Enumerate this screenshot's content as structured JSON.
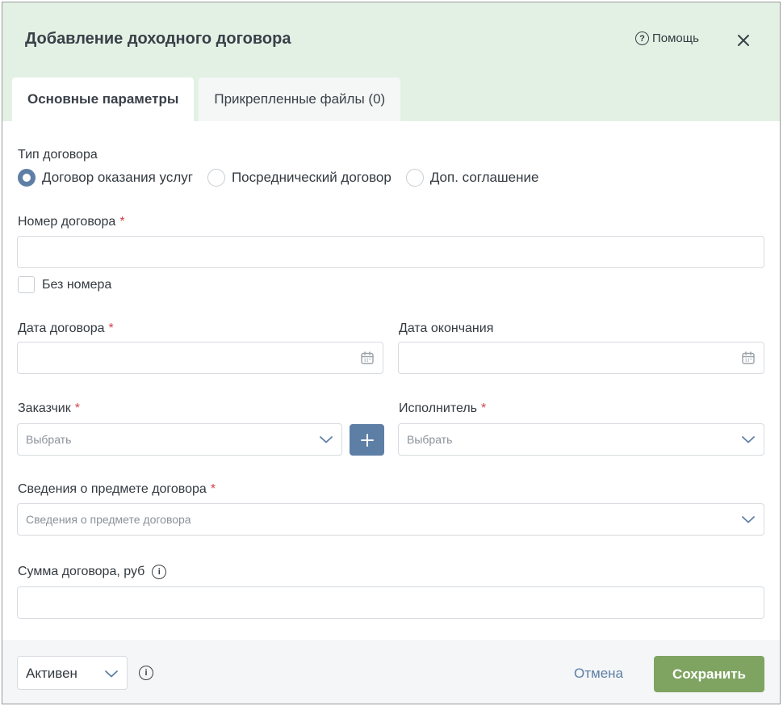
{
  "dialog": {
    "title": "Добавление доходного договора",
    "help_label": "Помощь"
  },
  "tabs": [
    {
      "label": "Основные параметры",
      "active": true
    },
    {
      "label": "Прикрепленные файлы (0)",
      "active": false
    }
  ],
  "contract_type": {
    "label": "Тип договора",
    "options": [
      {
        "label": "Договор оказания услуг",
        "checked": true
      },
      {
        "label": "Посреднический договор",
        "checked": false
      },
      {
        "label": "Доп. соглашение",
        "checked": false
      }
    ]
  },
  "contract_number": {
    "label": "Номер договора",
    "required_mark": "*",
    "value": "",
    "no_number_label": "Без номера"
  },
  "contract_date": {
    "label": "Дата договора",
    "required_mark": "*",
    "value": ""
  },
  "end_date": {
    "label": "Дата окончания",
    "value": ""
  },
  "customer": {
    "label": "Заказчик",
    "required_mark": "*",
    "placeholder": "Выбрать"
  },
  "executor": {
    "label": "Исполнитель",
    "required_mark": "*",
    "placeholder": "Выбрать"
  },
  "subject": {
    "label": "Сведения о предмете договора",
    "required_mark": "*",
    "placeholder": "Сведения о предмете договора"
  },
  "amount": {
    "label": "Сумма договора, руб",
    "value": ""
  },
  "footer": {
    "status_value": "Активен",
    "cancel_label": "Отмена",
    "save_label": "Сохранить"
  },
  "colors": {
    "header_bg": "#e3f1e5",
    "accent_blue": "#5e7fa5",
    "save_green": "#7fa462",
    "required_red": "#d2424a"
  },
  "icons": [
    "help-icon",
    "close-icon",
    "calendar-icon",
    "chevron-down-icon",
    "plus-icon",
    "info-icon"
  ]
}
